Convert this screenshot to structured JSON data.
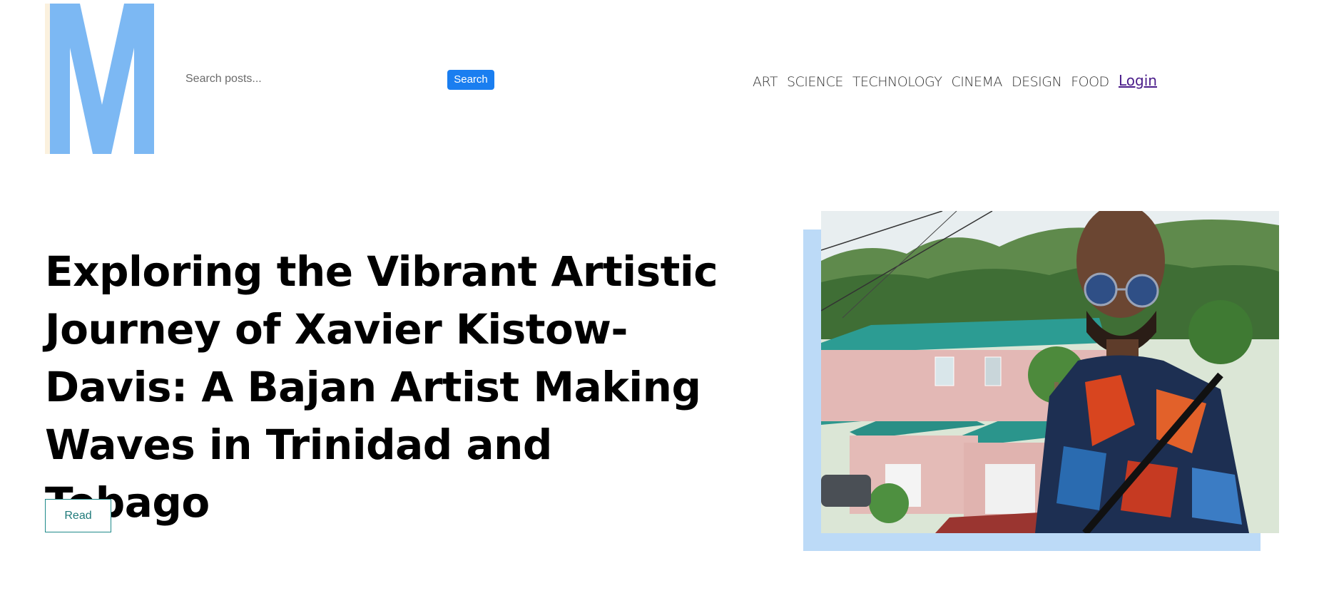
{
  "header": {
    "logo_letter": "M",
    "search": {
      "placeholder": "Search posts...",
      "value": "",
      "button_label": "Search"
    },
    "nav": [
      {
        "label": "ART"
      },
      {
        "label": "SCIENCE"
      },
      {
        "label": "TECHNOLOGY"
      },
      {
        "label": "CINEMA"
      },
      {
        "label": "DESIGN"
      },
      {
        "label": "FOOD"
      }
    ],
    "login_label": "Login"
  },
  "hero": {
    "title": "Exploring the Vibrant Artistic Journey of Xavier Kistow-Davis: A Bajan Artist Making Waves in Trinidad and Tobago",
    "read_label": "Read"
  },
  "colors": {
    "logo_blue": "#7cb8f3",
    "logo_shadow": "#fbf1de",
    "search_button": "#1a7ef0",
    "read_border": "#1f8a8a",
    "login_link": "#4a1c8a",
    "image_backdrop": "#bcdaf7"
  }
}
